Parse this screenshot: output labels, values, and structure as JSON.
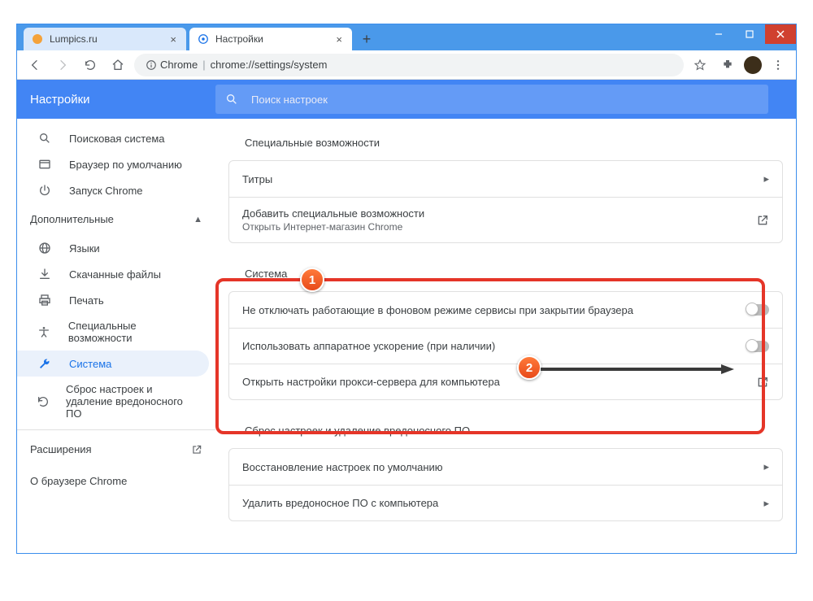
{
  "window": {
    "tabs": [
      {
        "title": "Lumpics.ru",
        "favicon": "circle-orange"
      },
      {
        "title": "Настройки",
        "favicon": "gear-blue"
      }
    ],
    "newTabAria": "+"
  },
  "omnibox": {
    "protoLabel": "Chrome",
    "url": "chrome://settings/system"
  },
  "header": {
    "title": "Настройки",
    "searchPlaceholder": "Поиск настроек"
  },
  "sidebar": {
    "items": [
      {
        "icon": "search-icon",
        "label": "Поисковая система"
      },
      {
        "icon": "window-icon",
        "label": "Браузер по умолчанию"
      },
      {
        "icon": "power-icon",
        "label": "Запуск Chrome"
      }
    ],
    "groupLabel": "Дополнительные",
    "advanced": [
      {
        "icon": "globe-icon",
        "label": "Языки"
      },
      {
        "icon": "download-icon",
        "label": "Скачанные файлы"
      },
      {
        "icon": "print-icon",
        "label": "Печать"
      },
      {
        "icon": "accessibility-icon",
        "label": "Специальные возможности"
      },
      {
        "icon": "wrench-icon",
        "label": "Система",
        "selected": true
      },
      {
        "icon": "restore-icon",
        "label": "Сброс настроек и удаление вредоносного ПО"
      }
    ],
    "extensions": "Расширения",
    "about": "О браузере Chrome"
  },
  "main": {
    "accessTitle": "Специальные возможности",
    "accessRows": [
      {
        "label": "Титры",
        "type": "chev"
      },
      {
        "label": "Добавить специальные возможности",
        "sub": "Открыть Интернет-магазин Chrome",
        "type": "launch"
      }
    ],
    "systemTitle": "Система",
    "systemRows": [
      {
        "label": "Не отключать работающие в фоновом режиме сервисы при закрытии браузера",
        "type": "toggle"
      },
      {
        "label": "Использовать аппаратное ускорение (при наличии)",
        "type": "toggle"
      },
      {
        "label": "Открыть настройки прокси-сервера для компьютера",
        "type": "launch"
      }
    ],
    "resetTitle": "Сброс настроек и удаление вредоносного ПО",
    "resetRows": [
      {
        "label": "Восстановление настроек по умолчанию",
        "type": "chev"
      },
      {
        "label": "Удалить вредоносное ПО с компьютера",
        "type": "chev"
      }
    ]
  },
  "callouts": {
    "one": "1",
    "two": "2"
  }
}
